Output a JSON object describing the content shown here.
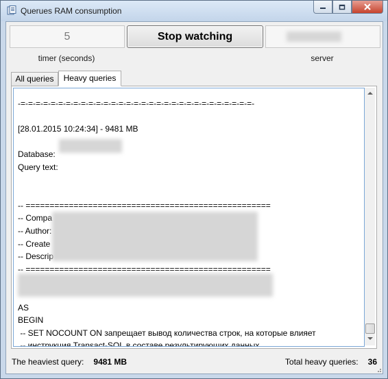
{
  "window": {
    "title": "Querues RAM consumption",
    "buttons": {
      "minimize": "minimize",
      "maximize": "maximize",
      "close": "close"
    }
  },
  "controls": {
    "timer_value": "5",
    "timer_label": "timer (seconds)",
    "stop_button": "Stop watching",
    "server_label": "server"
  },
  "tabs": [
    {
      "label": "All queries",
      "selected": false
    },
    {
      "label": "Heavy queries",
      "selected": true
    }
  ],
  "query_text": "-=-=-=-=-=-=-=-=-=-=-=-=-=-=-=-=-=-=-=-=-=-=-=-=-=-=-=-=-=-=-=-\n\n[28.01.2015 10:24:34] - 9481 MB\n\nDatabase:\nQuery text:\n\n\n-- ===================================================\n-- Compa\n-- Author:\n-- Create\n-- Descrip\n-- ===================================================\n\n\nAS\nBEGIN\n -- SET NOCOUNT ON запрещает вывод количества строк, на которые влияет\n -- инструкция Transact-SQL в составе результирующих данных",
  "status": {
    "heaviest_label": "The heaviest query:",
    "heaviest_value": "9481 MB",
    "total_label": "Total heavy queries:",
    "total_value": "36"
  },
  "colors": {
    "titlebar": "#c3d5ea",
    "close_button": "#c7442e",
    "text_border": "#7aa6d6"
  }
}
